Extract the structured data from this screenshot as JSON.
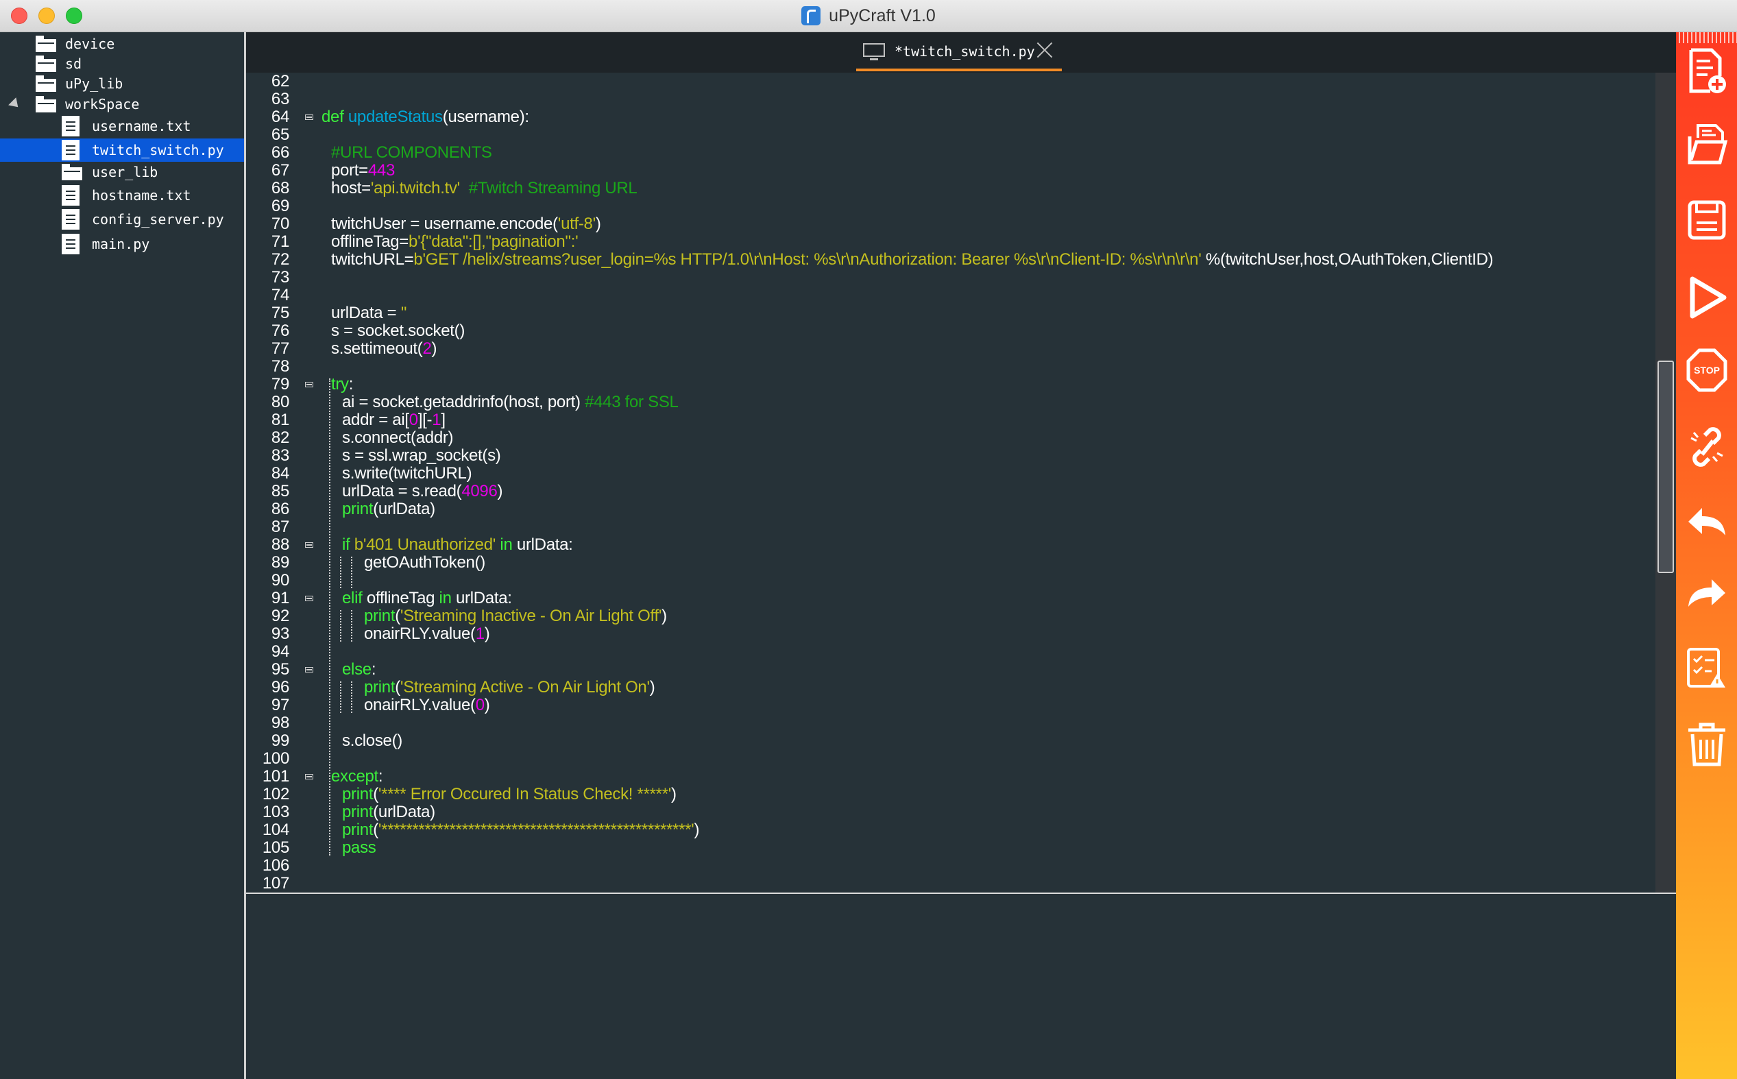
{
  "window": {
    "title": "uPyCraft V1.0"
  },
  "sidebar": {
    "items": [
      {
        "label": "device",
        "type": "folder",
        "level": 0,
        "expanded": false,
        "selected": false
      },
      {
        "label": "sd",
        "type": "folder",
        "level": 0,
        "expanded": false,
        "selected": false
      },
      {
        "label": "uPy_lib",
        "type": "folder",
        "level": 0,
        "expanded": false,
        "selected": false
      },
      {
        "label": "workSpace",
        "type": "folder",
        "level": 0,
        "expanded": true,
        "selected": false
      },
      {
        "label": "username.txt",
        "type": "file",
        "level": 1,
        "selected": false
      },
      {
        "label": "twitch_switch.py",
        "type": "file",
        "level": 1,
        "selected": true
      },
      {
        "label": "user_lib",
        "type": "folder",
        "level": 1,
        "selected": false
      },
      {
        "label": "hostname.txt",
        "type": "file",
        "level": 1,
        "selected": false
      },
      {
        "label": "config_server.py",
        "type": "file",
        "level": 1,
        "selected": false
      },
      {
        "label": "main.py",
        "type": "file",
        "level": 1,
        "selected": false
      }
    ]
  },
  "tabs": [
    {
      "label": "*twitch_switch.py",
      "active": true
    }
  ],
  "editor": {
    "lines": [
      {
        "n": "62",
        "segments": []
      },
      {
        "n": "63",
        "segments": []
      },
      {
        "n": "64",
        "fold": true,
        "segments": [
          {
            "t": "def ",
            "c": "kw"
          },
          {
            "t": "updateStatus",
            "c": "fn"
          },
          {
            "t": "(username):"
          }
        ]
      },
      {
        "n": "65",
        "segments": []
      },
      {
        "n": "66",
        "indent": 1,
        "segments": [
          {
            "t": "#URL COMPONENTS",
            "c": "cmt"
          }
        ]
      },
      {
        "n": "67",
        "indent": 1,
        "segments": [
          {
            "t": "port="
          },
          {
            "t": "443",
            "c": "num"
          }
        ]
      },
      {
        "n": "68",
        "indent": 1,
        "segments": [
          {
            "t": "host="
          },
          {
            "t": "'api.twitch.tv'",
            "c": "str"
          },
          {
            "t": "  "
          },
          {
            "t": "#Twitch Streaming URL",
            "c": "cmt"
          }
        ]
      },
      {
        "n": "69",
        "segments": []
      },
      {
        "n": "70",
        "indent": 1,
        "segments": [
          {
            "t": "twitchUser = username.encode("
          },
          {
            "t": "'utf-8'",
            "c": "str"
          },
          {
            "t": ")"
          }
        ]
      },
      {
        "n": "71",
        "indent": 1,
        "segments": [
          {
            "t": "offlineTag="
          },
          {
            "t": "b'{\"data\":[],\"pagination\":'",
            "c": "str"
          }
        ]
      },
      {
        "n": "72",
        "indent": 1,
        "segments": [
          {
            "t": "twitchURL="
          },
          {
            "t": "b'GET /helix/streams?user_login=%s HTTP/1.0\\r\\nHost: %s\\r\\nAuthorization: Bearer %s\\r\\nClient-ID: %s\\r\\n\\r\\n'",
            "c": "str"
          },
          {
            "t": " %(twitchUser,host,OAuthToken,ClientID)"
          }
        ]
      },
      {
        "n": "73",
        "segments": []
      },
      {
        "n": "74",
        "segments": []
      },
      {
        "n": "75",
        "indent": 1,
        "segments": [
          {
            "t": "urlData = "
          },
          {
            "t": "''",
            "c": "str"
          }
        ]
      },
      {
        "n": "76",
        "indent": 1,
        "segments": [
          {
            "t": "s = socket.socket()"
          }
        ]
      },
      {
        "n": "77",
        "indent": 1,
        "segments": [
          {
            "t": "s.settimeout("
          },
          {
            "t": "2",
            "c": "num"
          },
          {
            "t": ")"
          }
        ]
      },
      {
        "n": "78",
        "segments": []
      },
      {
        "n": "79",
        "fold": true,
        "indent": 1,
        "segments": [
          {
            "t": "try",
            "c": "kw"
          },
          {
            "t": ":"
          }
        ]
      },
      {
        "n": "80",
        "indent": 2,
        "segments": [
          {
            "t": "ai = socket.getaddrinfo(host, port) "
          },
          {
            "t": "#443 for SSL",
            "c": "cmt"
          }
        ]
      },
      {
        "n": "81",
        "indent": 2,
        "segments": [
          {
            "t": "addr = ai["
          },
          {
            "t": "0",
            "c": "num"
          },
          {
            "t": "][-"
          },
          {
            "t": "1",
            "c": "num"
          },
          {
            "t": "]"
          }
        ]
      },
      {
        "n": "82",
        "indent": 2,
        "segments": [
          {
            "t": "s.connect(addr)"
          }
        ]
      },
      {
        "n": "83",
        "indent": 2,
        "segments": [
          {
            "t": "s = ssl.wrap_socket(s)"
          }
        ]
      },
      {
        "n": "84",
        "indent": 2,
        "segments": [
          {
            "t": "s.write(twitchURL)"
          }
        ]
      },
      {
        "n": "85",
        "indent": 2,
        "segments": [
          {
            "t": "urlData = s.read("
          },
          {
            "t": "4096",
            "c": "num"
          },
          {
            "t": ")"
          }
        ]
      },
      {
        "n": "86",
        "indent": 2,
        "segments": [
          {
            "t": "print",
            "c": "kw"
          },
          {
            "t": "(urlData)"
          }
        ]
      },
      {
        "n": "87",
        "segments": []
      },
      {
        "n": "88",
        "fold": true,
        "indent": 2,
        "segments": [
          {
            "t": "if ",
            "c": "kw"
          },
          {
            "t": "b'401 Unauthorized'",
            "c": "str"
          },
          {
            "t": " in ",
            "c": "kw"
          },
          {
            "t": "urlData:"
          }
        ]
      },
      {
        "n": "89",
        "indent": 3,
        "segments": [
          {
            "t": "getOAuthToken()"
          }
        ]
      },
      {
        "n": "90",
        "segments": []
      },
      {
        "n": "91",
        "fold": true,
        "indent": 2,
        "segments": [
          {
            "t": "elif ",
            "c": "kw"
          },
          {
            "t": "offlineTag "
          },
          {
            "t": "in ",
            "c": "kw"
          },
          {
            "t": "urlData:"
          }
        ]
      },
      {
        "n": "92",
        "indent": 3,
        "segments": [
          {
            "t": "print",
            "c": "kw"
          },
          {
            "t": "("
          },
          {
            "t": "'Streaming Inactive - On Air Light Off'",
            "c": "str"
          },
          {
            "t": ")"
          }
        ]
      },
      {
        "n": "93",
        "indent": 3,
        "segments": [
          {
            "t": "onairRLY.value("
          },
          {
            "t": "1",
            "c": "num"
          },
          {
            "t": ")"
          }
        ]
      },
      {
        "n": "94",
        "segments": []
      },
      {
        "n": "95",
        "fold": true,
        "indent": 2,
        "segments": [
          {
            "t": "else",
            "c": "kw"
          },
          {
            "t": ":"
          }
        ]
      },
      {
        "n": "96",
        "indent": 3,
        "segments": [
          {
            "t": "print",
            "c": "kw"
          },
          {
            "t": "("
          },
          {
            "t": "'Streaming Active - On Air Light On'",
            "c": "str"
          },
          {
            "t": ")"
          }
        ]
      },
      {
        "n": "97",
        "indent": 3,
        "segments": [
          {
            "t": "onairRLY.value("
          },
          {
            "t": "0",
            "c": "num"
          },
          {
            "t": ")"
          }
        ]
      },
      {
        "n": "98",
        "segments": []
      },
      {
        "n": "99",
        "indent": 2,
        "segments": [
          {
            "t": "s.close()"
          }
        ]
      },
      {
        "n": "100",
        "segments": []
      },
      {
        "n": "101",
        "fold": true,
        "indent": 1,
        "segments": [
          {
            "t": "except",
            "c": "kw"
          },
          {
            "t": ":"
          }
        ]
      },
      {
        "n": "102",
        "indent": 2,
        "segments": [
          {
            "t": "print",
            "c": "kw"
          },
          {
            "t": "("
          },
          {
            "t": "'**** Error Occured In Status Check! *****'",
            "c": "str"
          },
          {
            "t": ")"
          }
        ]
      },
      {
        "n": "103",
        "indent": 2,
        "segments": [
          {
            "t": "print",
            "c": "kw"
          },
          {
            "t": "(urlData)"
          }
        ]
      },
      {
        "n": "104",
        "indent": 2,
        "segments": [
          {
            "t": "print",
            "c": "kw"
          },
          {
            "t": "("
          },
          {
            "t": "'**************************************************'",
            "c": "str"
          },
          {
            "t": ")"
          }
        ]
      },
      {
        "n": "105",
        "indent": 2,
        "segments": [
          {
            "t": "pass",
            "c": "kw"
          }
        ]
      },
      {
        "n": "106",
        "segments": []
      },
      {
        "n": "107",
        "segments": []
      }
    ]
  },
  "toolbar": {
    "buttons": [
      {
        "name": "new-file-button",
        "icon": "new-file-icon"
      },
      {
        "name": "open-file-button",
        "icon": "open-file-icon"
      },
      {
        "name": "save-button",
        "icon": "save-icon"
      },
      {
        "name": "run-button",
        "icon": "play-icon"
      },
      {
        "name": "stop-button",
        "icon": "stop-icon",
        "text": "STOP"
      },
      {
        "name": "connect-button",
        "icon": "link-icon"
      },
      {
        "name": "undo-button",
        "icon": "undo-icon"
      },
      {
        "name": "redo-button",
        "icon": "redo-icon"
      },
      {
        "name": "syntax-check-button",
        "icon": "syntax-check-icon"
      },
      {
        "name": "clear-button",
        "icon": "trash-icon"
      }
    ]
  },
  "colors": {
    "background": "#263238",
    "keyword": "#3cf03c",
    "function": "#00a6d6",
    "string": "#c3bf1f",
    "number": "#e400e4",
    "comment": "#1aa81a",
    "selection": "#0a59d9",
    "toolbar_top": "#ff3a22",
    "toolbar_bottom": "#ffc22a",
    "tab_accent": "#f28b26"
  }
}
